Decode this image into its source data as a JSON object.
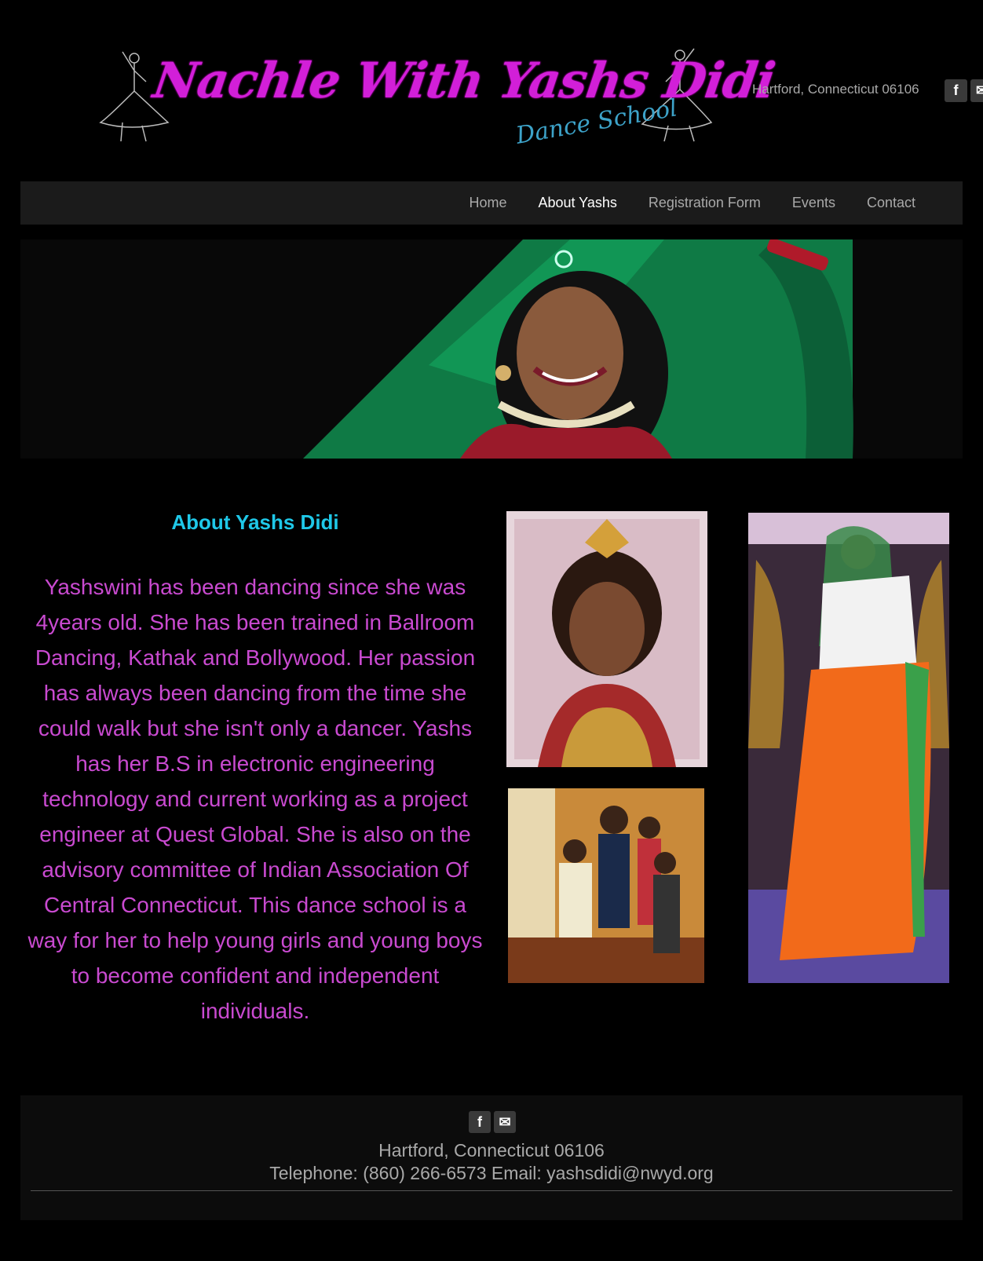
{
  "header": {
    "logo_title": "Nachle With Yashs Didi",
    "logo_subtitle": "Dance School",
    "location": "Hartford, Connecticut 06106",
    "social": [
      {
        "icon": "facebook-icon",
        "glyph": "f"
      },
      {
        "icon": "mail-icon",
        "glyph": "✉"
      }
    ]
  },
  "nav": {
    "items": [
      {
        "label": "Home"
      },
      {
        "label": "About Yashs"
      },
      {
        "label": "Registration Form"
      },
      {
        "label": "Events"
      },
      {
        "label": "Contact"
      }
    ],
    "active": "About Yashs"
  },
  "main": {
    "title": "About Yashs Didi",
    "body": "Yashswini has been dancing since she was 4years old. She has been trained in Ballroom Dancing, Kathak and Bollywood. Her passion has always been dancing from the time she could walk but she isn't only a dancer. Yashs has her B.S in electronic engineering technology and current working as a project engineer at Quest Global. She is also on the advisory committee of Indian Association Of Central Connecticut. This dance school is a way for her to help young girls and young boys to become confident and independent individuals."
  },
  "footer": {
    "address": "Hartford, Connecticut 06106",
    "contact": "Telephone: (860) 266-6573 Email: yashsdidi@nwyd.org",
    "social": [
      {
        "icon": "facebook-icon",
        "glyph": "f"
      },
      {
        "icon": "mail-icon",
        "glyph": "✉"
      }
    ]
  },
  "colors": {
    "accent_title": "#1fc8e8",
    "body_text": "#c94ad0",
    "logo_magenta": "#d21fd8",
    "nav_bg": "#1b1b1b"
  }
}
